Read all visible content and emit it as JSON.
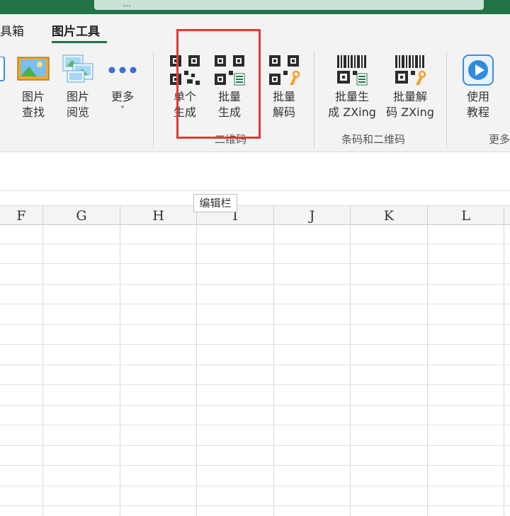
{
  "window": {
    "title_partial": "…"
  },
  "tabs": [
    {
      "label": "具箱",
      "active": false
    },
    {
      "label": "图片工具",
      "active": true
    }
  ],
  "ribbon": {
    "buttons": [
      {
        "id": "left-cut",
        "label_line1": "",
        "label_line2": ""
      },
      {
        "id": "image-find",
        "label_line1": "图片",
        "label_line2": "查找"
      },
      {
        "id": "image-browse",
        "label_line1": "图片",
        "label_line2": "阅览"
      },
      {
        "id": "more",
        "label_line1": "更多",
        "label_line2": "˅"
      },
      {
        "id": "single-generate",
        "label_line1": "单个",
        "label_line2": "生成"
      },
      {
        "id": "batch-generate",
        "label_line1": "批量",
        "label_line2": "生成"
      },
      {
        "id": "batch-decode",
        "label_line1": "批量",
        "label_line2": "解码"
      },
      {
        "id": "batch-gen-zxing",
        "label_line1": "批量生",
        "label_line2": "成 ZXing"
      },
      {
        "id": "batch-dec-zxing",
        "label_line1": "批量解",
        "label_line2": "码 ZXing"
      },
      {
        "id": "tutorial",
        "label_line1": "使用",
        "label_line2": "教程"
      }
    ],
    "groups": [
      {
        "label": "二维码"
      },
      {
        "label": "条码和二维码"
      },
      {
        "label": "更多"
      }
    ]
  },
  "tooltip": "编辑栏",
  "columns": [
    "F",
    "G",
    "H",
    "I",
    "J",
    "K",
    "L"
  ],
  "colors": {
    "accent": "#217346",
    "highlight": "#e53935"
  }
}
